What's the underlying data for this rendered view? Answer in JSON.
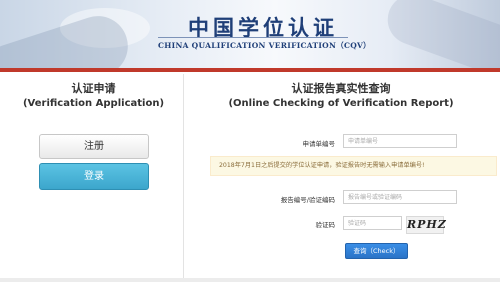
{
  "header": {
    "title_cn": "中国学位认证",
    "title_en": "CHINA QUALIFICATION VERIFICATION（CQV）"
  },
  "left_panel": {
    "title": "认证申请",
    "subtitle": "(Verification Application)",
    "register_label": "注册",
    "login_label": "登录"
  },
  "right_panel": {
    "title": "认证报告真实性查询",
    "subtitle": "(Online Checking of Verification Report)",
    "application_no_label": "申请单编号",
    "application_no_placeholder": "申请单编号",
    "notice": "2018年7月1日之后提交的学位认证申请，验证报告时无需输入申请单编号!",
    "report_no_label": "报告编号/验证编码",
    "report_no_placeholder": "报告编号或验证编码",
    "captcha_label": "验证码",
    "captcha_placeholder": "验证码",
    "captcha_text": "RPHZ",
    "check_button_label": "查询（Check）"
  }
}
